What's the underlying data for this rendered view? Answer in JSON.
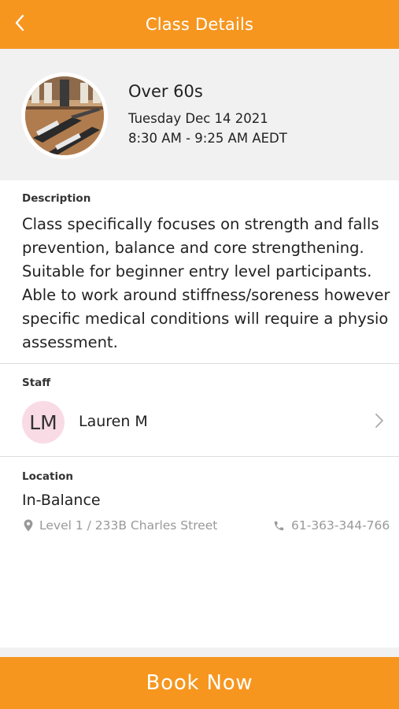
{
  "header": {
    "title": "Class Details",
    "back_icon": "chevron-left-icon"
  },
  "class_summary": {
    "name": "Over 60s",
    "date": "Tuesday Dec 14 2021",
    "time": "8:30 AM - 9:25 AM AEDT",
    "photo": "pilates-studio-photo"
  },
  "description": {
    "label": "Description",
    "text": "Class specifically focuses on strength and falls prevention, balance and core strengthening. Suitable for beginner entry level participants. Able to work around stiffness/soreness however specific medical conditions will require a physio assessment."
  },
  "staff": {
    "label": "Staff",
    "initials": "LM",
    "name": "Lauren M",
    "chevron_icon": "chevron-right-icon"
  },
  "location": {
    "label": "Location",
    "name": "In-Balance",
    "address": "Level 1 / 233B Charles Street",
    "phone": "61-363-344-766",
    "address_icon": "map-pin-icon",
    "phone_icon": "phone-icon"
  },
  "footer": {
    "book_label": "Book Now"
  },
  "colors": {
    "accent": "#f6961f",
    "summary_background": "#f1f1f1",
    "avatar_background": "#f9dbe6",
    "muted_text": "#999999"
  }
}
